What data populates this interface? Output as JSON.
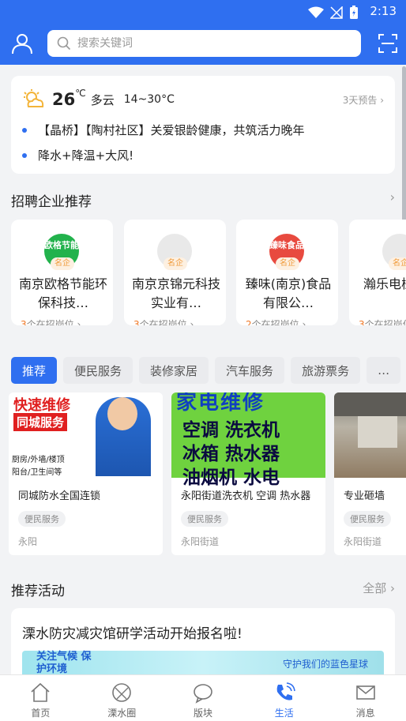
{
  "status_bar": {
    "time": "2:13"
  },
  "header": {
    "search_placeholder": "搜索关键词"
  },
  "weather": {
    "temperature": "26",
    "unit": "℃",
    "condition": "多云",
    "range": "14~30°C",
    "forecast_link": "3天预告",
    "news": [
      "【晶桥】【陶村社区】关爱银龄健康，共筑活力晚年",
      "降水+降温+大风!"
    ]
  },
  "recruit": {
    "title": "招聘企业推荐",
    "companies": [
      {
        "logo_text": "欧格节能",
        "tag": "名企",
        "name": "南京欧格节能环保科技…",
        "count": "3",
        "count_suffix": "个在招岗位",
        "logo_color": "#22b24c"
      },
      {
        "logo_text": "",
        "tag": "名企",
        "name": "南京京锦元科技实业有…",
        "count": "3",
        "count_suffix": "个在招岗位",
        "logo_color": "#e5e5e5"
      },
      {
        "logo_text": "臻味食品",
        "tag": "名企",
        "name": "臻味(南京)食品有限公…",
        "count": "2",
        "count_suffix": "个在招岗位",
        "logo_color": "#e84a3f"
      },
      {
        "logo_text": "",
        "tag": "名企",
        "name": "瀚乐电械（南京",
        "count": "3",
        "count_suffix": "个在招岗位",
        "logo_color": "#e5e5e5"
      }
    ]
  },
  "tabs": [
    "推荐",
    "便民服务",
    "装修家居",
    "汽车服务",
    "旅游票务",
    "…"
  ],
  "services": [
    {
      "title": "同城防水全国连锁",
      "category": "便民服务",
      "location": "永阳",
      "img_text": [
        "快速维修",
        "同城服务",
        "厨房/外墙/楼顶",
        "阳台/卫生间等"
      ]
    },
    {
      "title": "永阳街道洗衣机 空调 热水器",
      "category": "便民服务",
      "location": "永阳街道",
      "img_text": [
        "家电维修",
        "空调 洗衣机",
        "冰箱 热水器",
        "油烟机 水电"
      ]
    },
    {
      "title": "专业砸墙",
      "category": "便民服务",
      "location": "永阳街道",
      "img_text": []
    }
  ],
  "activities": {
    "title": "推荐活动",
    "more": "全部",
    "item_title": "溧水防灾减灾馆研学活动开始报名啦!",
    "banner_left": "关注气候 保护环境",
    "banner_right": "守护我们的蓝色星球"
  },
  "bottom_nav": [
    {
      "label": "首页",
      "icon": "home-icon"
    },
    {
      "label": "溧水圈",
      "icon": "circle-icon"
    },
    {
      "label": "版块",
      "icon": "chat-icon"
    },
    {
      "label": "生活",
      "icon": "phone-icon",
      "active": true
    },
    {
      "label": "消息",
      "icon": "mail-icon"
    }
  ],
  "colors": {
    "brand": "#2f6ff0",
    "accent_orange": "#f07a2a"
  }
}
